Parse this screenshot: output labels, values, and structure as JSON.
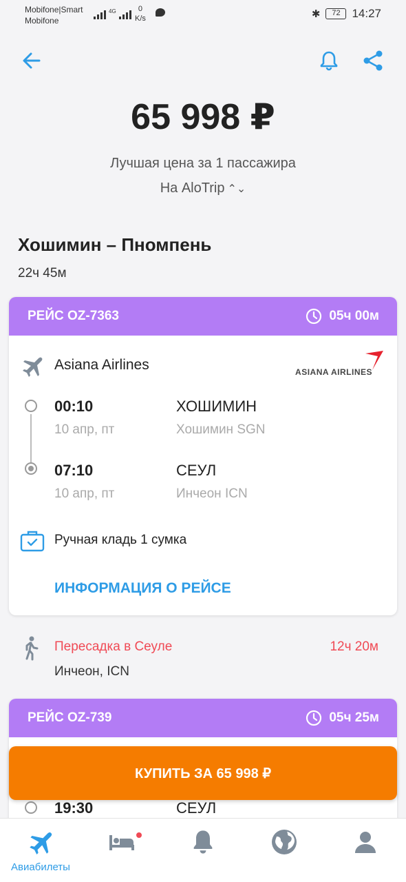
{
  "status_bar": {
    "carrier_line1": "Mobifone|Smart",
    "carrier_line2": "Mobifone",
    "net_speed_value": "0",
    "net_speed_unit": "K/s",
    "network_type": "4G",
    "battery": "72",
    "time": "14:27"
  },
  "header": {
    "price": "65 998 ₽",
    "price_caption": "Лучшая цена за 1 пассажира",
    "source": "На AloTrip"
  },
  "route": {
    "title": "Хошимин – Пномпень",
    "duration": "22ч 45м"
  },
  "flights": [
    {
      "flight_label": "РЕЙС OZ-7363",
      "duration": "05ч 00м",
      "airline": "Asiana Airlines",
      "airline_logo_text": "ASIANA AIRLINES",
      "departure": {
        "time": "00:10",
        "date": "10 апр, пт",
        "city": "ХОШИМИН",
        "airport": "Хошимин SGN"
      },
      "arrival": {
        "time": "07:10",
        "date": "10 апр, пт",
        "city": "СЕУЛ",
        "airport": "Инчеон ICN"
      },
      "baggage": "Ручная кладь 1 сумка",
      "info_link": "ИНФОРМАЦИЯ О РЕЙСЕ"
    },
    {
      "flight_label": "РЕЙС OZ-739",
      "duration": "05ч 25м",
      "departure": {
        "time": "19:30",
        "city": "СЕУЛ"
      }
    }
  ],
  "transfer": {
    "title": "Пересадка в Сеуле",
    "airport": "Инчеон, ICN",
    "duration": "12ч 20м"
  },
  "buy_button": "КУПИТЬ ЗА 65 998 ₽",
  "tabs": [
    {
      "icon": "airplane-icon",
      "label": "Авиабилеты",
      "active": true
    },
    {
      "icon": "hotel-bed-icon",
      "label": "",
      "badge": true
    },
    {
      "icon": "bell-icon",
      "label": ""
    },
    {
      "icon": "globe-icon",
      "label": ""
    },
    {
      "icon": "profile-icon",
      "label": ""
    }
  ],
  "colors": {
    "accent": "#2e9ce6",
    "flight_header": "#b37cf5",
    "buy_button": "#f57c00",
    "transfer_text": "#f04a55",
    "background": "#f4f4f6"
  }
}
